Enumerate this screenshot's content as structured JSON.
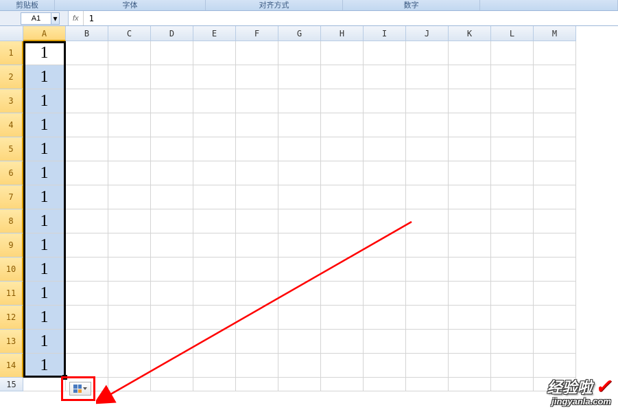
{
  "ribbon": {
    "groups": [
      "剪贴板",
      "字体",
      "对齐方式",
      "数字"
    ]
  },
  "name_box": "A1",
  "fx_label": "fx",
  "formula_value": "1",
  "columns": [
    "A",
    "B",
    "C",
    "D",
    "E",
    "F",
    "G",
    "H",
    "I",
    "J",
    "K",
    "L",
    "M"
  ],
  "rows": [
    "1",
    "2",
    "3",
    "4",
    "5",
    "6",
    "7",
    "8",
    "9",
    "10",
    "11",
    "12",
    "13",
    "14",
    "15"
  ],
  "selected_col": "A",
  "selected_rows_count": 14,
  "cell_values": {
    "A": [
      "1",
      "1",
      "1",
      "1",
      "1",
      "1",
      "1",
      "1",
      "1",
      "1",
      "1",
      "1",
      "1",
      "1"
    ]
  },
  "watermark": {
    "title": "经验啦",
    "check": "✓",
    "domain": "jingyanla.com"
  },
  "icons": {
    "dropdown": "▾"
  }
}
